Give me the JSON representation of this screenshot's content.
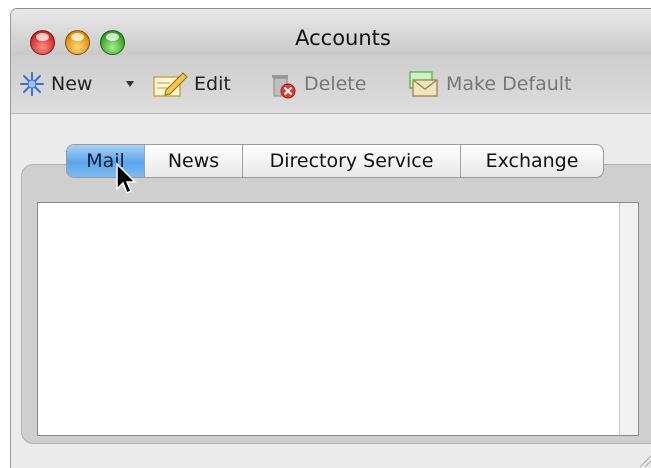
{
  "window": {
    "title": "Accounts"
  },
  "toolbar": {
    "new_label": "New",
    "new_icon": "new-star-icon",
    "edit_label": "Edit",
    "delete_label": "Delete",
    "make_default_label": "Make Default"
  },
  "tabs": [
    {
      "label": "Mail",
      "selected": true
    },
    {
      "label": "News",
      "selected": false
    },
    {
      "label": "Directory Service",
      "selected": false
    },
    {
      "label": "Exchange",
      "selected": false
    }
  ],
  "accounts_list": {
    "items": []
  },
  "colors": {
    "selected_tab": "#5aa6eb",
    "close": "#d3271f",
    "minimize": "#e08a00",
    "zoom": "#2f9f1c"
  }
}
